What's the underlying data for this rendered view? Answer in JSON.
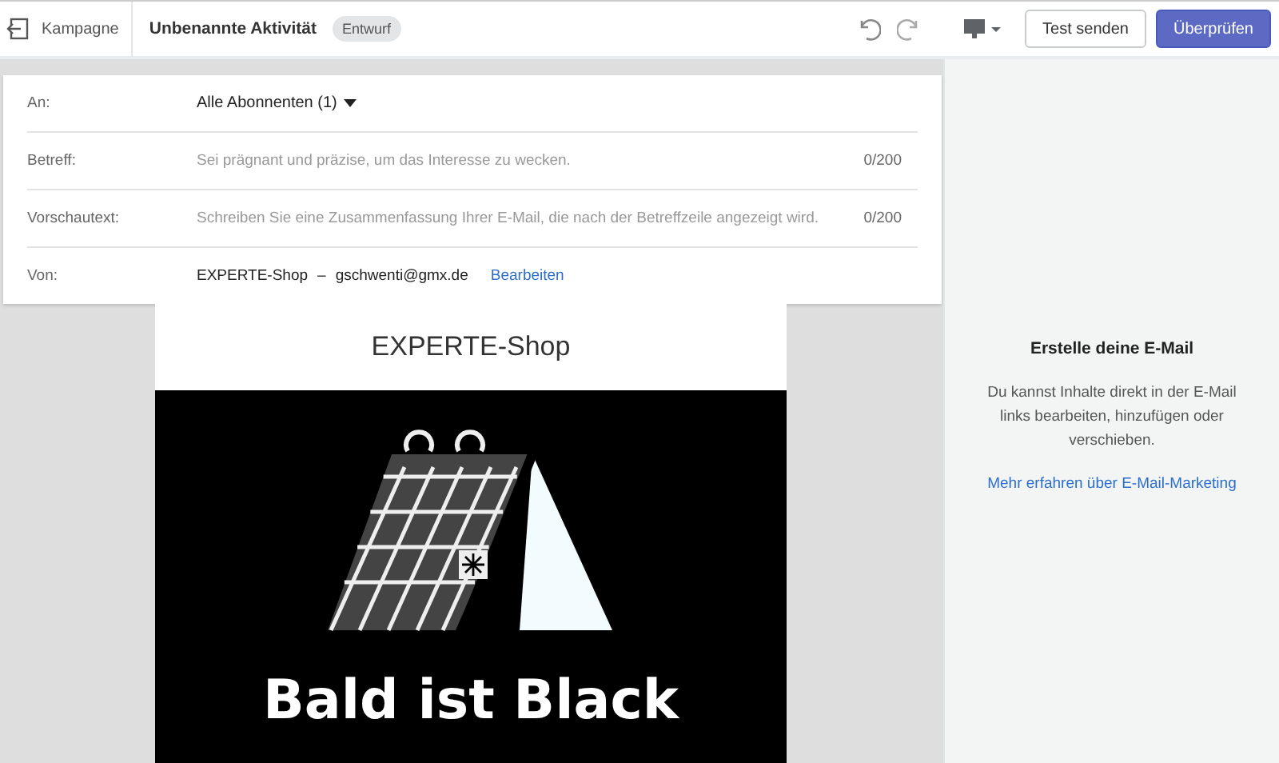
{
  "topbar": {
    "back_label": "Kampagne",
    "title": "Unbenannte Aktivität",
    "status_badge": "Entwurf",
    "buttons": [
      {
        "label": "Test senden",
        "kind": "secondary"
      },
      {
        "label": "Überprüfen",
        "kind": "primary"
      }
    ]
  },
  "form": {
    "to": {
      "label": "An:",
      "value": "Alle Abonnenten (1)"
    },
    "fields": [
      {
        "label": "Betreff:",
        "placeholder": "Sei prägnant und präzise, um das Interesse zu wecken.",
        "counter": "0/200"
      },
      {
        "label": "Vorschautext:",
        "placeholder": "Schreiben Sie eine Zusammenfassung Ihrer E-Mail, die nach der Betreffzeile angezeigt wird.",
        "counter": "0/200"
      }
    ],
    "from": {
      "label": "Von:",
      "name": "EXPERTE-Shop",
      "separator": "–",
      "email": "gschwenti@gmx.de",
      "edit_link": "Bearbeiten"
    }
  },
  "preview": {
    "shop_name": "EXPERTE-Shop",
    "headline": "Bald ist Black"
  },
  "side_panel": {
    "title": "Erstelle deine E-Mail",
    "text": "Du kannst Inhalte direkt in der E-Mail links bearbeiten, hinzufügen oder verschieben.",
    "link": "Mehr erfahren über E-Mail-Marketing"
  }
}
